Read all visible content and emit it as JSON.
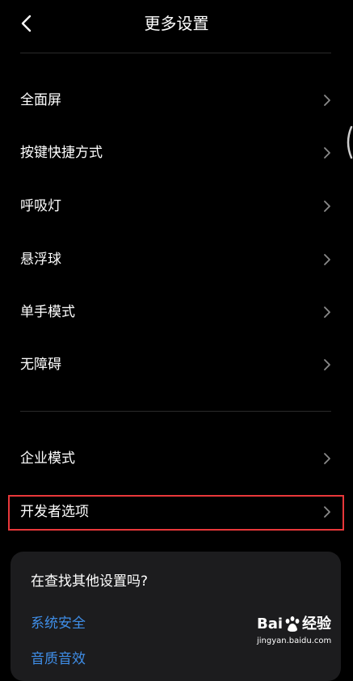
{
  "header": {
    "title": "更多设置",
    "back_icon": "chevron-left-icon"
  },
  "group1": [
    {
      "label": "全面屏"
    },
    {
      "label": "按键快捷方式"
    },
    {
      "label": "呼吸灯"
    },
    {
      "label": "悬浮球"
    },
    {
      "label": "单手模式"
    },
    {
      "label": "无障碍"
    }
  ],
  "group2": [
    {
      "label": "企业模式"
    },
    {
      "label": "开发者选项"
    }
  ],
  "suggest": {
    "title": "在查找其他设置吗?",
    "links": [
      "系统安全",
      "音质音效"
    ]
  },
  "watermark": {
    "brand_left": "Bai",
    "brand_right": "经验",
    "url": "jingyan.baidu.com"
  },
  "colors": {
    "background": "#000000",
    "link": "#3f8ee8",
    "highlight": "#e8373a",
    "card": "#1c1c1e"
  }
}
